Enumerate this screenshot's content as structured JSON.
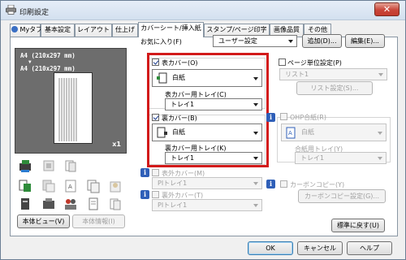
{
  "window": {
    "title": "印刷設定",
    "close_label": "✕"
  },
  "tabs": [
    {
      "label": "Myタブ"
    },
    {
      "label": "基本設定"
    },
    {
      "label": "レイアウト"
    },
    {
      "label": "仕上げ"
    },
    {
      "label": "カバーシート/挿入紙"
    },
    {
      "label": "スタンプ/ページ印字"
    },
    {
      "label": "画像品質"
    },
    {
      "label": "その他"
    }
  ],
  "preview": {
    "line1": "A4 (210x297 mm)",
    "arrow": "▼",
    "line2": "A4 (210x297 mm)",
    "count": "x1"
  },
  "favorites": {
    "label": "お気に入り(F)",
    "value": "ユーザー設定",
    "add_label": "追加(D)...",
    "edit_label": "編集(E)..."
  },
  "front_cover": {
    "label": "表カバー(O)",
    "checked": true,
    "paper": "白紙",
    "tray_label": "表カバー用トレイ(C)",
    "tray": "トレイ1"
  },
  "back_cover": {
    "label": "裏カバー(B)",
    "checked": true,
    "paper": "白紙",
    "tray_label": "裏カバー用トレイ(K)",
    "tray": "トレイ1"
  },
  "page_settings": {
    "label": "ページ単位設定(P)",
    "list_value": "リスト1",
    "list_button": "リスト設定(S)..."
  },
  "ohp": {
    "label": "OHP合紙(R)",
    "paper": "白紙",
    "tray_label": "合紙用トレイ(Y)",
    "tray": "トレイ1"
  },
  "front_cover2": {
    "label": "表外カバー(M)",
    "tray": "PIトレイ1"
  },
  "back_cover2": {
    "label": "裏外カバー(T)",
    "tray": "PIトレイ1"
  },
  "carbon": {
    "label": "カーボンコピー(Y)",
    "button": "カーボンコピー設定(G)..."
  },
  "left_buttons": {
    "view": "本体ビュー(V)",
    "info": "本体情報(I)"
  },
  "reset_label": "標準に戻す(U)",
  "footer": {
    "ok": "OK",
    "cancel": "キャンセル",
    "help": "ヘルプ"
  },
  "colors": {
    "highlight": "#d21a1a",
    "preview_bg": "#6d6d6d",
    "info": "#2f5fb8"
  }
}
